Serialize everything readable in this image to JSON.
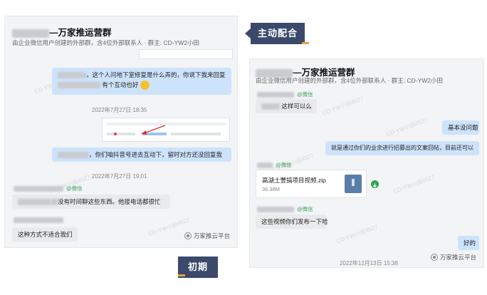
{
  "labels": {
    "top_right": "主动配合",
    "bottom_left": "初期"
  },
  "left": {
    "group_title": "—万家推运营群",
    "subtitle": "由企业微信用户创建的外部群，含4位外部联系人 · 群主: CD-YW2小田",
    "msg1_line1": "，这个人问地下室修复是什么弄的，你说下我来回复",
    "msg1_line2": "有个互动也好",
    "time1": "2022年7月27日 18:35",
    "msg2": "，你们咱抖音号进去互动下，留时对方还没回复我",
    "time2": "2022年7月27日 19:01",
    "sender_tag": "@微信",
    "msg3": "没有时间聊这些东西。他接电话都很忙",
    "msg4": "这种方式不适合我们",
    "brand": "万家推云平台"
  },
  "right": {
    "group_title": "—万家推运营群",
    "subtitle": "由企业微信用户创建的外部群，含4位外部联系人 · 群主: CD-YW2小田",
    "sender_tag": "@微信",
    "msg1": "这样可以么",
    "msg2": "基本没问题",
    "msg3": "就是通过你们的业余进行招募出的文案回帖，目前还可以",
    "file_name": "高湖土豐搞项目视频.zip",
    "file_size": "36.38M",
    "msg4": "这些视频你们发布一下哈",
    "msg5": "好的",
    "brand": "万家推云平台",
    "time": "2022年12月13日 15:38"
  },
  "watermark_text": "CD-YW小田4527",
  "colors": {
    "bubble_blue": "#cde3fb",
    "panel_bg": "#f3f4f6",
    "flag_bg": "#3b4a6b",
    "flag_accent": "#e8a33d",
    "sender_green": "#3aa35a"
  }
}
